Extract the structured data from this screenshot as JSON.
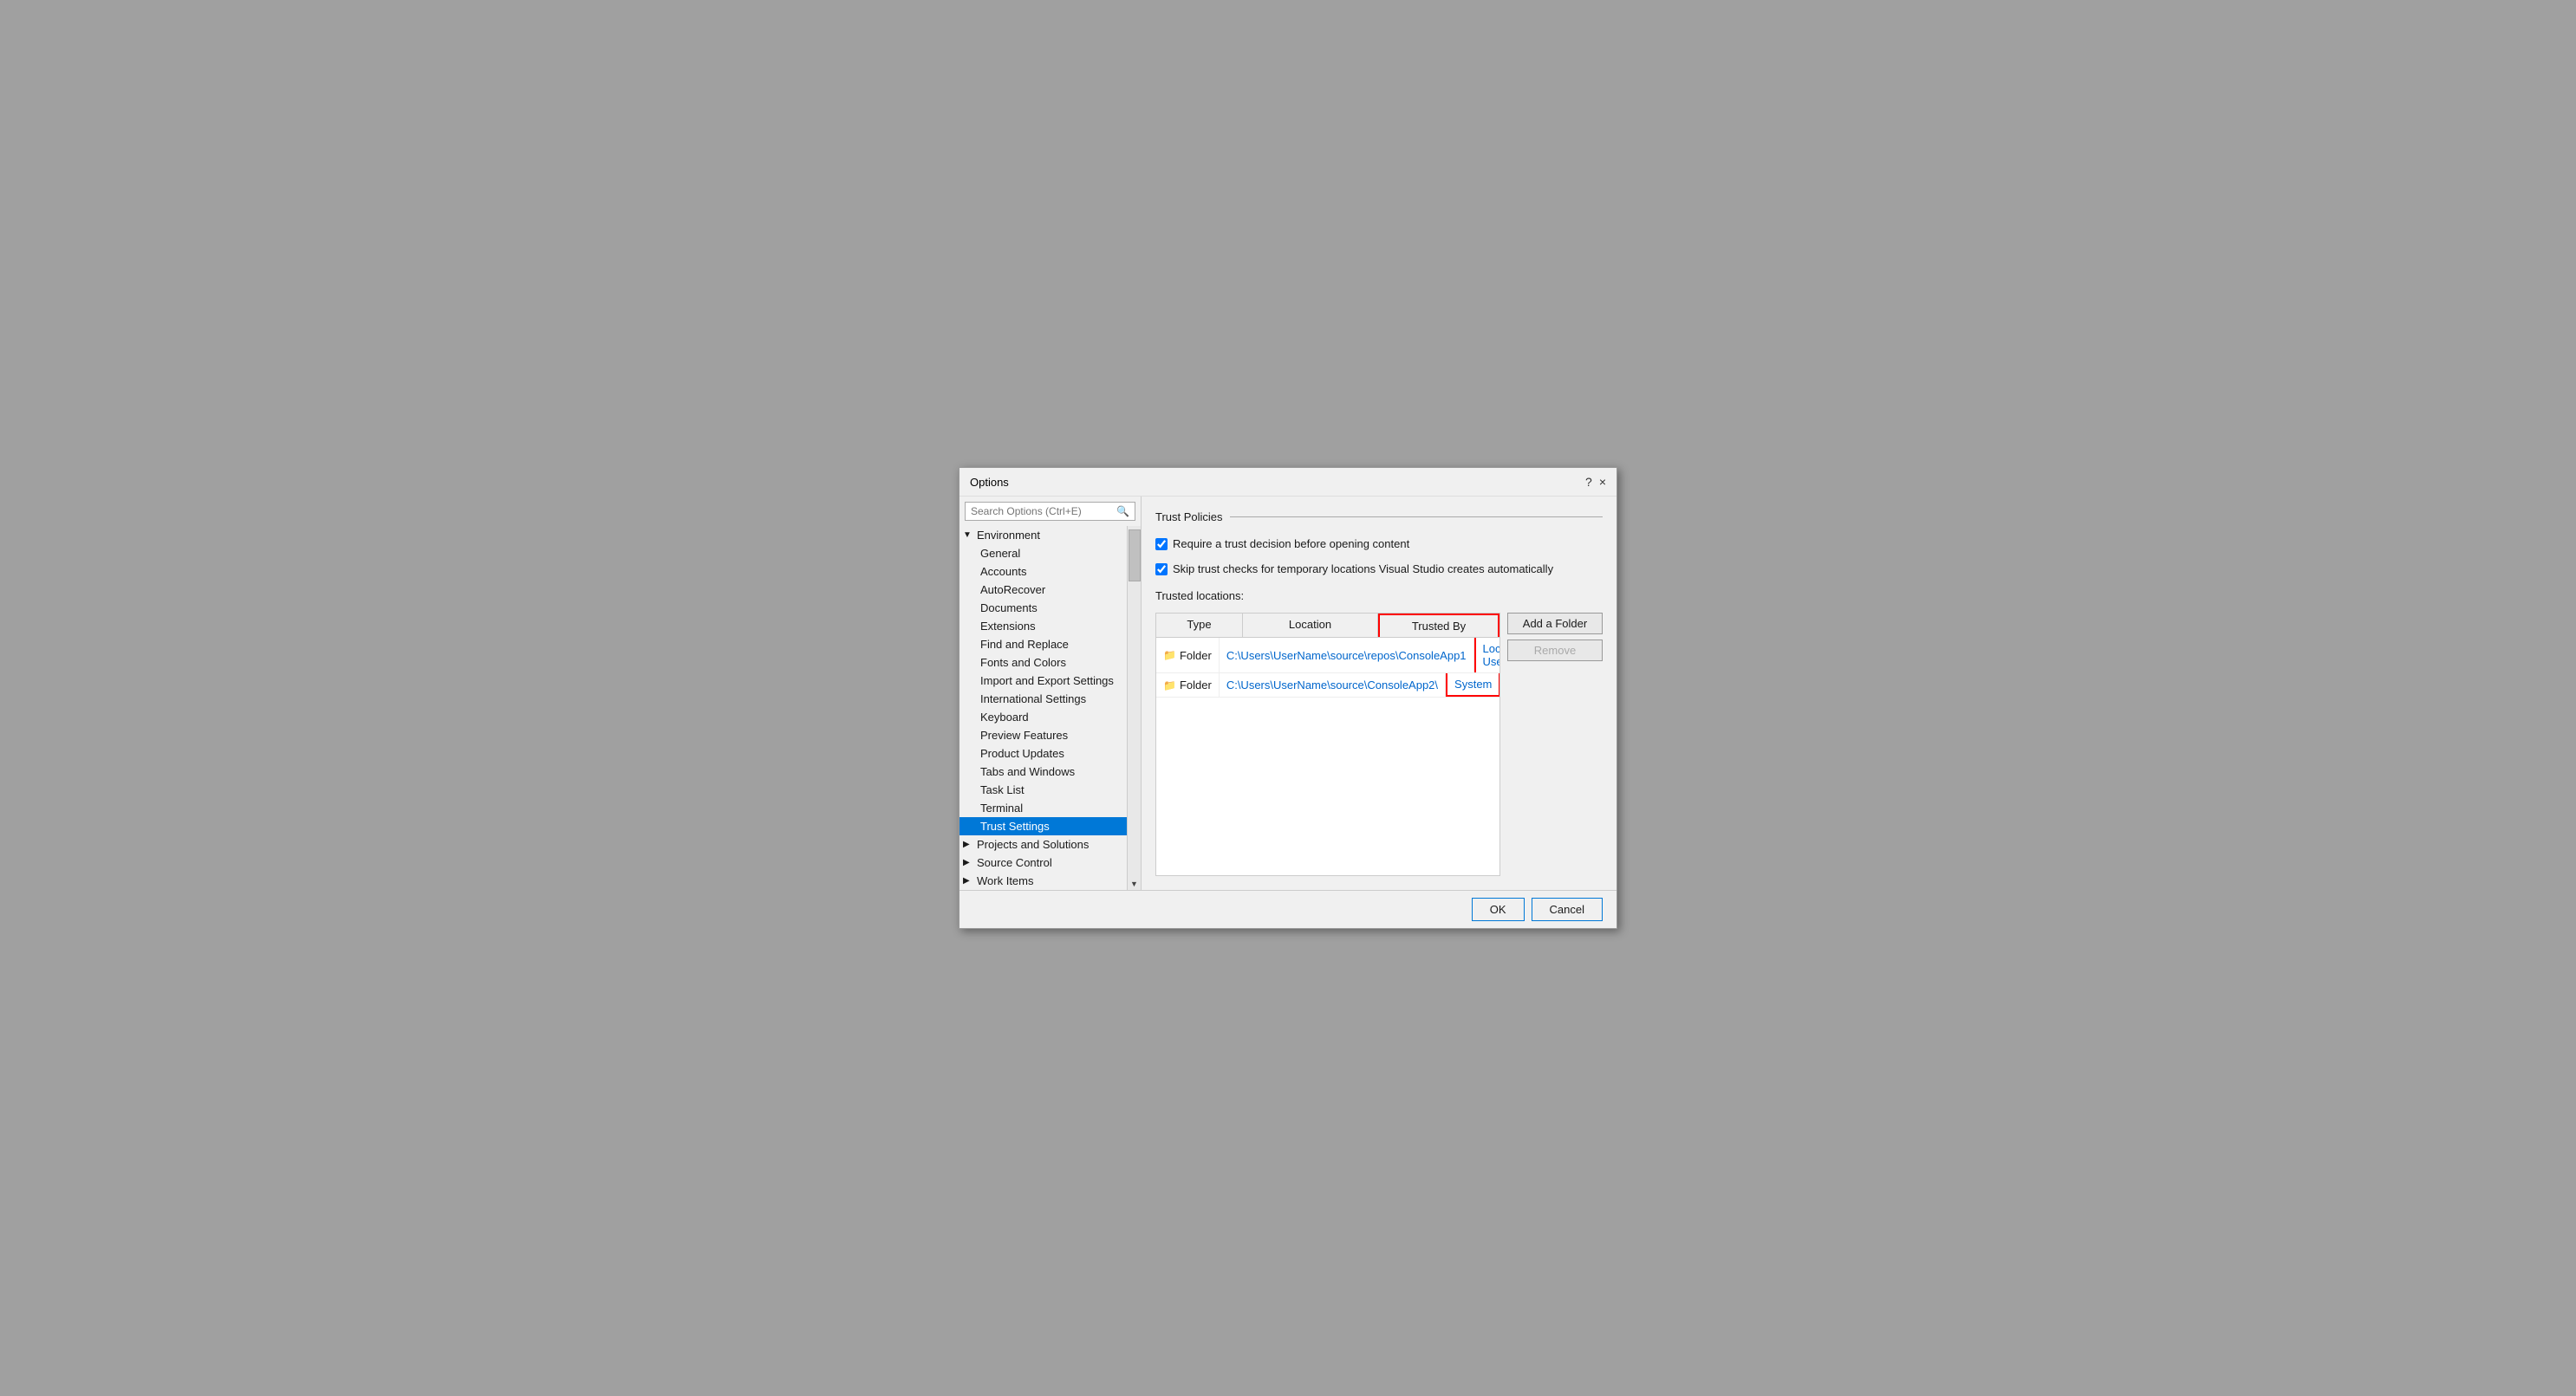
{
  "dialog": {
    "title": "Options",
    "help_label": "?",
    "close_label": "×"
  },
  "search": {
    "placeholder": "Search Options (Ctrl+E)"
  },
  "sidebar": {
    "environment_label": "Environment",
    "items": [
      {
        "label": "General",
        "type": "child"
      },
      {
        "label": "Accounts",
        "type": "child"
      },
      {
        "label": "AutoRecover",
        "type": "child"
      },
      {
        "label": "Documents",
        "type": "child"
      },
      {
        "label": "Extensions",
        "type": "child"
      },
      {
        "label": "Find and Replace",
        "type": "child"
      },
      {
        "label": "Fonts and Colors",
        "type": "child"
      },
      {
        "label": "Import and Export Settings",
        "type": "child"
      },
      {
        "label": "International Settings",
        "type": "child"
      },
      {
        "label": "Keyboard",
        "type": "child"
      },
      {
        "label": "Preview Features",
        "type": "child"
      },
      {
        "label": "Product Updates",
        "type": "child"
      },
      {
        "label": "Tabs and Windows",
        "type": "child"
      },
      {
        "label": "Task List",
        "type": "child"
      },
      {
        "label": "Terminal",
        "type": "child"
      },
      {
        "label": "Trust Settings",
        "type": "child",
        "selected": true
      }
    ],
    "collapsed_items": [
      {
        "label": "Projects and Solutions",
        "type": "parent"
      },
      {
        "label": "Source Control",
        "type": "parent"
      },
      {
        "label": "Work Items",
        "type": "parent"
      }
    ]
  },
  "main": {
    "section_title": "Trust Policies",
    "checkbox1_label": "Require a trust decision before opening content",
    "checkbox2_label": "Skip trust checks for temporary locations Visual Studio creates automatically",
    "trusted_locations_label": "Trusted locations:",
    "table": {
      "headers": [
        "Type",
        "Location",
        "Trusted By"
      ],
      "rows": [
        {
          "type": "Folder",
          "location": "C:\\Users\\UserName\\source\\repos\\ConsoleApp1",
          "trusted_by": "Local User"
        },
        {
          "type": "Folder",
          "location": "C:\\Users\\UserName\\source\\ConsoleApp2\\",
          "trusted_by": "System"
        }
      ]
    },
    "add_folder_label": "Add a Folder",
    "remove_label": "Remove"
  },
  "footer": {
    "ok_label": "OK",
    "cancel_label": "Cancel"
  }
}
